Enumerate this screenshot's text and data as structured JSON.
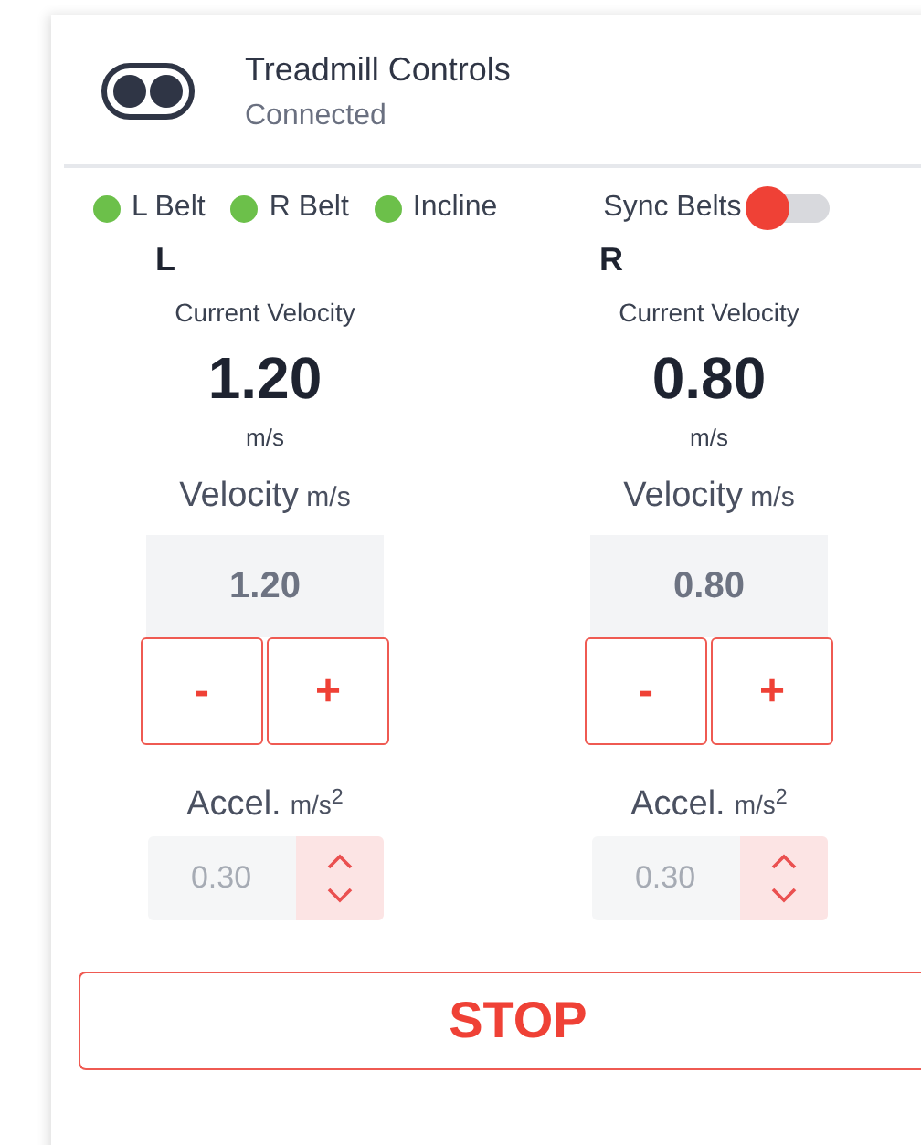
{
  "header": {
    "title": "Treadmill Controls",
    "status": "Connected"
  },
  "indicators": [
    {
      "label": "L Belt",
      "color": "#6cc04a"
    },
    {
      "label": "R Belt",
      "color": "#6cc04a"
    },
    {
      "label": "Incline",
      "color": "#6cc04a"
    }
  ],
  "sync": {
    "label": "Sync Belts",
    "on": false
  },
  "belts": [
    {
      "name": "L",
      "current_label": "Current Velocity",
      "current_value": "1.20",
      "current_unit": "m/s",
      "velocity_label": "Velocity",
      "velocity_unit": "m/s",
      "velocity_value": "1.20",
      "minus": "-",
      "plus": "+",
      "accel_label": "Accel.",
      "accel_unit": "m/s$^{2}$",
      "accel_value": "0.30"
    },
    {
      "name": "R",
      "current_label": "Current Velocity",
      "current_value": "0.80",
      "current_unit": "m/s",
      "velocity_label": "Velocity",
      "velocity_unit": "m/s",
      "velocity_value": "0.80",
      "minus": "-",
      "plus": "+",
      "accel_label": "Accel.",
      "accel_unit": "m/s$^{2}$",
      "accel_value": "0.30"
    }
  ],
  "stop_button": "STOP"
}
